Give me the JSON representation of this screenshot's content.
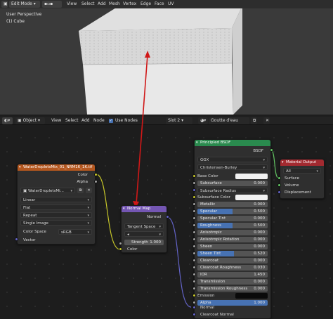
{
  "viewport": {
    "mode": "Edit Mode",
    "menus": [
      "View",
      "Select",
      "Add",
      "Mesh",
      "Vertex",
      "Edge",
      "Face",
      "UV"
    ],
    "overlay_title": "User Perspective",
    "overlay_object": "(1) Cube"
  },
  "node_editor": {
    "object_type": "Object",
    "menus": [
      "View",
      "Select",
      "Add",
      "Node"
    ],
    "use_nodes_label": "Use Nodes",
    "slot": "Slot 2",
    "material": "Goutte d'eau"
  },
  "image_node": {
    "title": "WaterDropletsMix_01_NRM16_1K.tif",
    "outputs": [
      "Color",
      "Alpha"
    ],
    "image_name": "WaterDropletsMi...",
    "interpolation": "Linear",
    "projection": "Flat",
    "extension": "Repeat",
    "source": "Single Image",
    "colorspace_label": "Color Space",
    "colorspace": "sRGB",
    "input": "Vector"
  },
  "normal_map_node": {
    "title": "Normal Map",
    "output": "Normal",
    "space": "Tangent Space",
    "strength_label": "Strength",
    "strength": "1.000",
    "input": "Color"
  },
  "bsdf_node": {
    "title": "Principled BSDF",
    "output": "BSDF",
    "distribution": "GGX",
    "sss_method": "Christensen-Burley",
    "rows": [
      {
        "label": "Base Color",
        "value": "",
        "kind": "color"
      },
      {
        "label": "Subsurface",
        "value": "0.000",
        "kind": "field"
      },
      {
        "label": "Subsurface Radius",
        "value": "",
        "kind": "dropdown"
      },
      {
        "label": "Subsurface Color",
        "value": "",
        "kind": "color"
      },
      {
        "label": "Metallic",
        "value": "0.000",
        "kind": "field"
      },
      {
        "label": "Specular",
        "value": "0.500",
        "kind": "blue"
      },
      {
        "label": "Specular Tint",
        "value": "0.000",
        "kind": "field"
      },
      {
        "label": "Roughness",
        "value": "0.500",
        "kind": "blue"
      },
      {
        "label": "Anisotropic",
        "value": "0.000",
        "kind": "field"
      },
      {
        "label": "Anisotropic Rotation",
        "value": "0.000",
        "kind": "field"
      },
      {
        "label": "Sheen",
        "value": "0.000",
        "kind": "field"
      },
      {
        "label": "Sheen Tint",
        "value": "0.520",
        "kind": "blue"
      },
      {
        "label": "Clearcoat",
        "value": "0.000",
        "kind": "field"
      },
      {
        "label": "Clearcoat Roughness",
        "value": "0.030",
        "kind": "field"
      },
      {
        "label": "IOR",
        "value": "1.450",
        "kind": "field"
      },
      {
        "label": "Transmission",
        "value": "0.000",
        "kind": "field"
      },
      {
        "label": "Transmission Roughness",
        "value": "0.000",
        "kind": "field"
      },
      {
        "label": "Emission",
        "value": "",
        "kind": "dark"
      },
      {
        "label": "Alpha",
        "value": "1.000",
        "kind": "fullblue"
      }
    ],
    "inputs_tail": [
      "Normal",
      "Clearcoat Normal"
    ]
  },
  "output_node": {
    "title": "Material Output",
    "target": "All",
    "inputs": [
      "Surface",
      "Volume",
      "Displacement"
    ]
  },
  "colors": {
    "image_header": "#b4571f",
    "vector_header": "#7456b3",
    "shader_header": "#2a8a4e",
    "output_header": "#a32a30",
    "arrow": "#d01818"
  }
}
